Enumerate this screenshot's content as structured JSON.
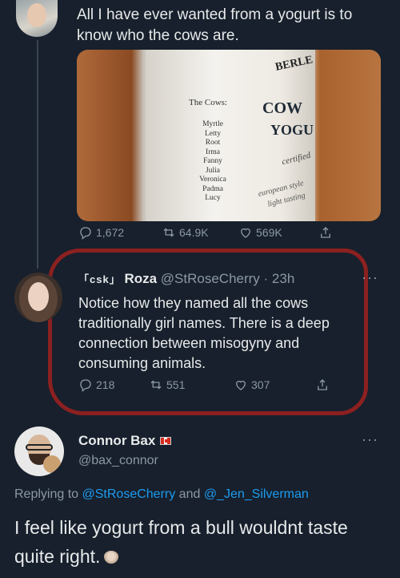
{
  "tweet1": {
    "text": "All I have ever wanted from a yogurt is to know who the cows are.",
    "image": {
      "cows_title": "The Cows:",
      "cows": [
        "Myrtle",
        "Letty",
        "Root",
        "Irma",
        "Fanny",
        "Julia",
        "Veronica",
        "Padma",
        "Lucy"
      ],
      "brand": "BERLE",
      "label1": "COW",
      "label2": "YOGU",
      "certified": "certified",
      "european": "european style",
      "light": "light tasting"
    },
    "actions": {
      "replies": "1,672",
      "retweets": "64.9K",
      "likes": "569K"
    }
  },
  "tweet2": {
    "bracket": "「csk」",
    "name": "Roza",
    "handle": "@StRoseCherry",
    "time": "23h",
    "text": "Notice how they named all the cows traditionally girl names. There is a deep connection between misogyny and consuming animals.",
    "actions": {
      "replies": "218",
      "retweets": "551",
      "likes": "307"
    }
  },
  "tweet3": {
    "name": "Connor Bax",
    "handle": "@bax_connor",
    "replying_prefix": "Replying to ",
    "replying_to_1": "@StRoseCherry",
    "replying_and": " and ",
    "replying_to_2": "@_Jen_Silverman",
    "text": "I feel like yogurt from a bull wouldnt taste quite right."
  },
  "more_icon": "···",
  "colors": {
    "background": "#17202c",
    "text": "#e7e9ea",
    "muted": "#8b98a5",
    "link": "#1d9bf0",
    "highlight": "#8c2020"
  }
}
